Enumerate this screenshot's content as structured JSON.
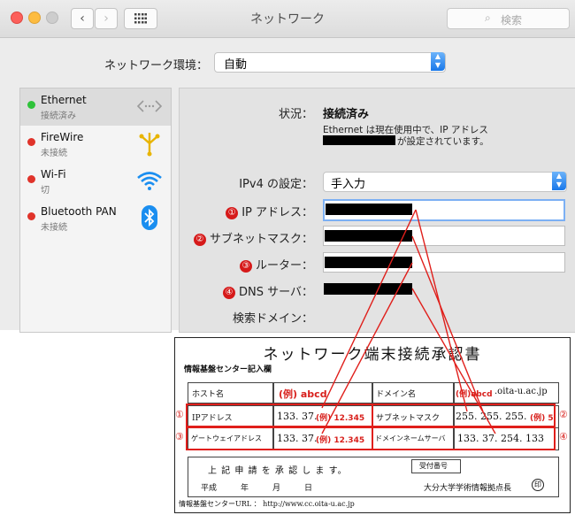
{
  "window": {
    "title": "ネットワーク",
    "search_placeholder": "検索",
    "grid_icon": "grid-icon"
  },
  "location": {
    "label": "ネットワーク環境：",
    "value": "自動"
  },
  "services": [
    {
      "name": "Ethernet",
      "status": "接続済み",
      "status_color": "#2fc23a",
      "icon": "ethernet-icon"
    },
    {
      "name": "FireWire",
      "status": "未接続",
      "status_color": "#e0332a",
      "icon": "firewire-icon"
    },
    {
      "name": "Wi-Fi",
      "status": "切",
      "status_color": "#e0332a",
      "icon": "wifi-icon"
    },
    {
      "name": "Bluetooth PAN",
      "status": "未接続",
      "status_color": "#e0332a",
      "icon": "bluetooth-icon"
    }
  ],
  "detail": {
    "status_label": "状況：",
    "status_value": "接続済み",
    "status_desc1": "Ethernet は現在使用中で、IP アドレス",
    "status_desc2": "が設定されています。",
    "ipv4_label": "IPv4 の設定：",
    "ipv4_value": "手入力",
    "ip_label": "IP アドレス：",
    "subnet_label": "サブネットマスク：",
    "router_label": "ルーター：",
    "dns_label": "DNS サーバ：",
    "search_domain_label": "検索ドメイン："
  },
  "markers": [
    "①",
    "②",
    "③",
    "④"
  ],
  "form": {
    "title": "ネットワーク端末接続承認書",
    "section": "情報基盤センター記入欄",
    "host_label": "ホスト名",
    "host_example": "(例) abcd",
    "domain_label": "ドメイン名",
    "domain_example_red": "(例)abcd",
    "domain_suffix": ".oita-u.ac.jp",
    "ip_label": "IPアドレス",
    "ip_value": "133. 37.",
    "ip_example": "(例) 12.345",
    "subnet_label": "サブネットマスク",
    "subnet_value": "255. 255. 255.",
    "subnet_example": "(例) 5",
    "gateway_label": "ゲートウェイアドレス",
    "gateway_value": "133. 37.",
    "gateway_example": "(例) 12.345",
    "dns_label": "ドメインネームサーバ",
    "dns_value": "133. 37. 254. 133",
    "approve_text": "上 記 申 請 を 承 認 し ま す。",
    "stamp_label": "受付番号",
    "date_text": "平成　　　年　　　月　　　日",
    "signer": "大分大学学術情報拠点長",
    "seal": "印",
    "footer": "情報基盤センターURL ： http://www.cc.oita-u.ac.jp"
  },
  "colors": {
    "accent": "#1978ea",
    "annotation": "#e01f1b"
  }
}
